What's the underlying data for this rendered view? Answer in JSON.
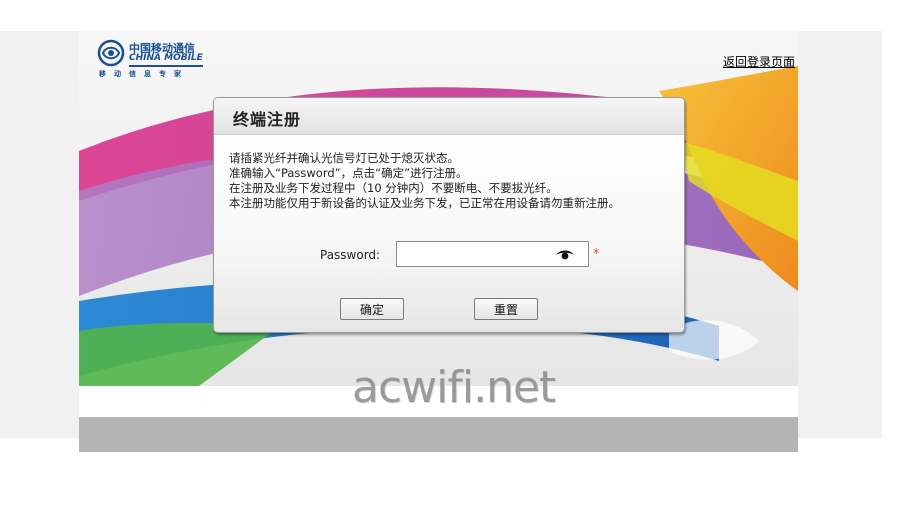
{
  "brand": {
    "name_cn": "中国移动通信",
    "name_en": "CHINA MOBILE",
    "tagline": "移动信息专家",
    "color": "#1a4f95"
  },
  "header": {
    "back_link": "返回登录页面"
  },
  "dialog": {
    "title": "终端注册",
    "instructions": [
      "请插紧光纤并确认光信号灯已处于熄灭状态。",
      "准确输入“Password”，点击“确定”进行注册。",
      "在注册及业务下发过程中（10 分钟内）不要断电、不要拔光纤。",
      "本注册功能仅用于新设备的认证及业务下发，已正常在用设备请勿重新注册。"
    ],
    "password_label": "Password:",
    "password_value": "",
    "show_password_icon": "eye-icon",
    "required_mark": "*",
    "confirm_button": "确定",
    "reset_button": "重置"
  },
  "watermark": "acwifi.net",
  "colors": {
    "required": "#e0601d",
    "footer": "#b4b4b4",
    "band_pink": "#e0418f",
    "band_purple": "#9a5fb5",
    "band_blue": "#2a79c9",
    "band_green": "#58b84a",
    "band_orange": "#f0a52a"
  }
}
